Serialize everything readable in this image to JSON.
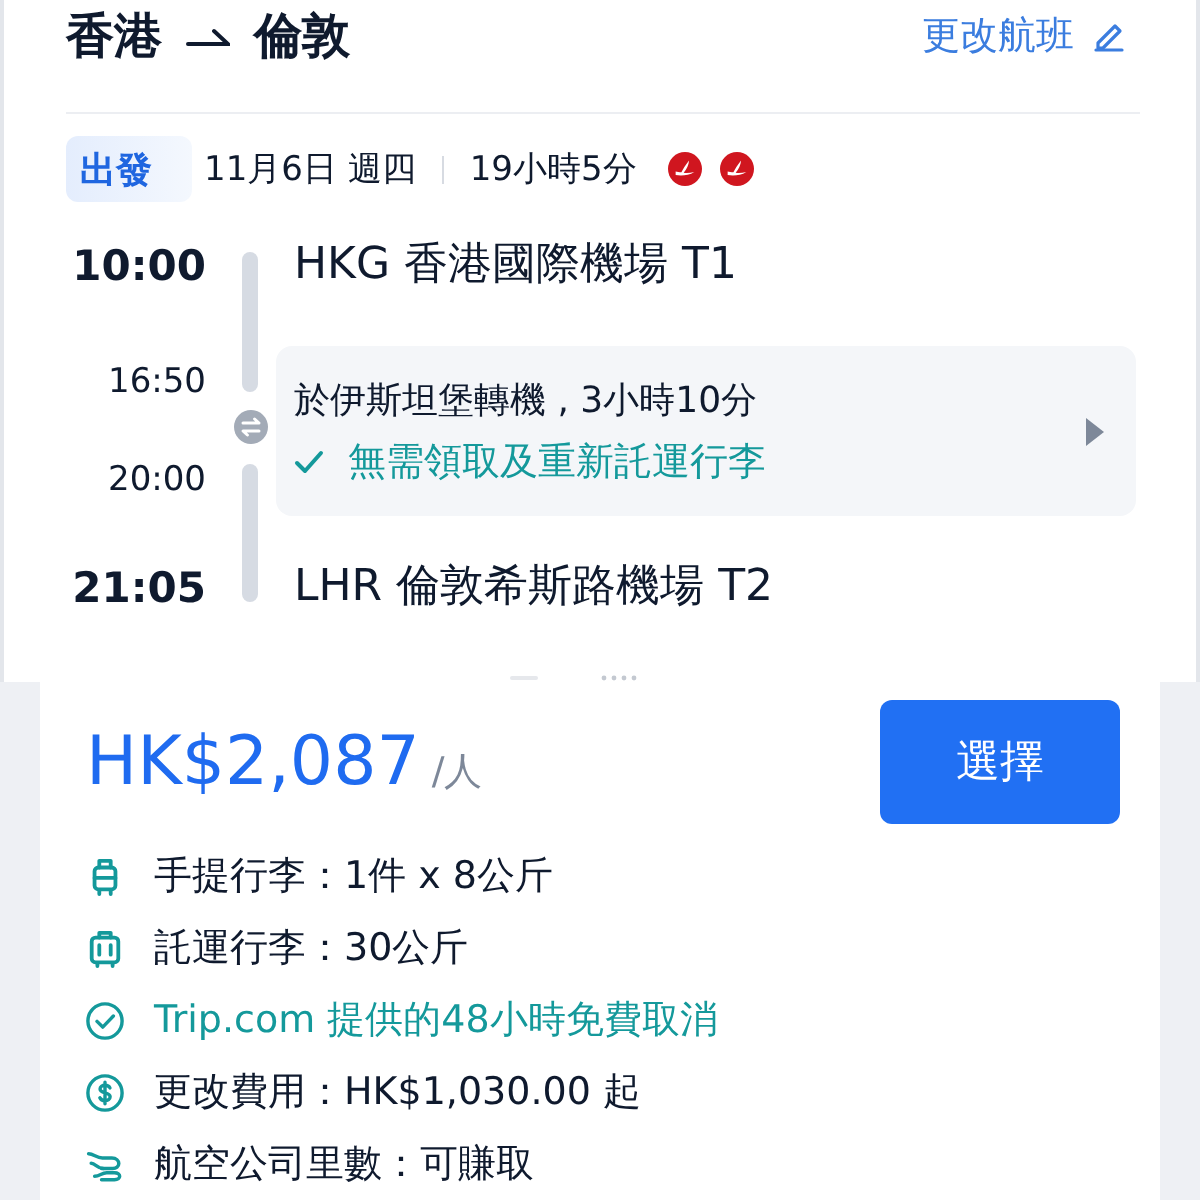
{
  "header": {
    "origin": "香港",
    "destination": "倫敦",
    "change_link": "更改航班"
  },
  "departure": {
    "tag": "出發",
    "date": "11月6日 週四",
    "duration": "19小時5分"
  },
  "itinerary": {
    "departure": {
      "time": "10:00",
      "airport": "HKG 香港國際機場 T1"
    },
    "transfer": {
      "arrival_time": "16:50",
      "departure_time": "20:00",
      "description": "於伊斯坦堡轉機 , 3小時10分",
      "note": "無需領取及重新託運行李"
    },
    "arrival": {
      "time": "21:05",
      "airport": "LHR 倫敦希斯路機場 T2"
    }
  },
  "fare": {
    "price": "HK$2,087",
    "unit": "/人",
    "select_button": "選擇"
  },
  "features": [
    {
      "kind": "cabin_bag",
      "text": "手提行李：1件 x 8公斤"
    },
    {
      "kind": "checked_bag",
      "text": "託運行李：30公斤"
    },
    {
      "kind": "free_cancellation",
      "text": "Trip.com 提供的48小時免費取消"
    },
    {
      "kind": "change_fee",
      "text": "更改費用：HK$1,030.00 起"
    },
    {
      "kind": "miles",
      "text": "航空公司里數：可賺取"
    }
  ]
}
